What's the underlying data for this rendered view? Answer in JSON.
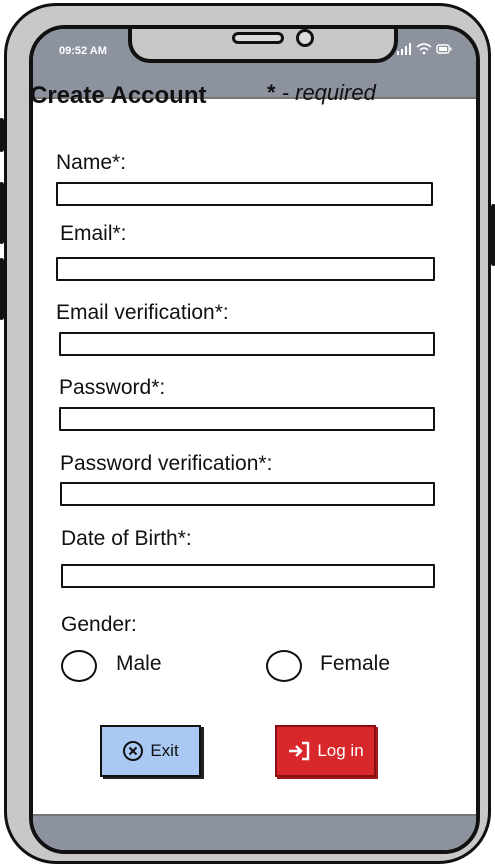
{
  "status_bar": {
    "time": "09:52 AM"
  },
  "header": {
    "title": "Create Account",
    "required_star": "*",
    "required_note": " - required"
  },
  "form": {
    "fields": [
      {
        "label": "Name*:"
      },
      {
        "label": "Email*:"
      },
      {
        "label": "Email verification*:"
      },
      {
        "label": "Password*:"
      },
      {
        "label": "Password verification*:"
      },
      {
        "label": "Date of Birth*:"
      }
    ],
    "gender": {
      "label": "Gender:",
      "options": [
        "Male",
        "Female"
      ]
    }
  },
  "buttons": {
    "exit_label": "Exit",
    "login_label": "Log in"
  },
  "colors": {
    "phone_body": "#c8c8c8",
    "bar": "#8c939f",
    "exit_bg": "#a9c8f4",
    "login_bg": "#d9282c"
  }
}
